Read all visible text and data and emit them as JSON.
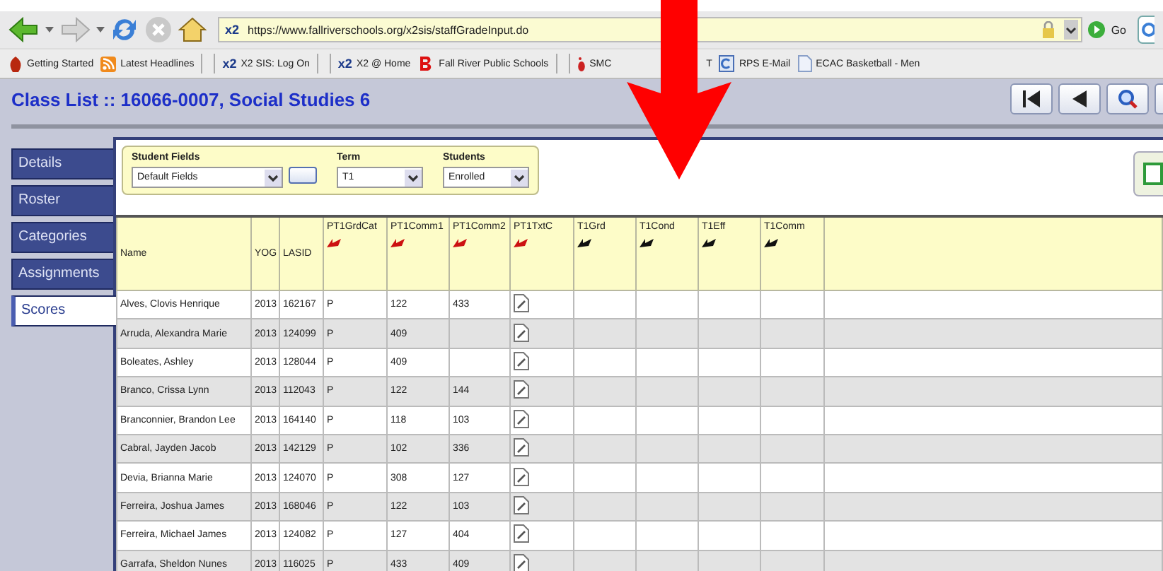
{
  "browser": {
    "site_badge": "x2",
    "url": "https://www.fallriverschools.org/x2sis/staffGradeInput.do",
    "go_label": "Go",
    "bookmarks": [
      {
        "label": "Getting Started",
        "kind": "start"
      },
      {
        "label": "Latest Headlines",
        "kind": "rss"
      },
      {
        "label": "X2 SIS: Log On",
        "kind": "x2",
        "badge": "x2"
      },
      {
        "label": "X2 @ Home",
        "kind": "x2",
        "badge": "x2"
      },
      {
        "label": "Fall River Public Schools",
        "kind": "school"
      },
      {
        "label": "SMC",
        "kind": "foot"
      },
      {
        "label": "T",
        "kind": "none"
      },
      {
        "label": "RPS E-Mail",
        "kind": "mail"
      },
      {
        "label": "ECAC Basketball - Men",
        "kind": "page"
      }
    ]
  },
  "page_title": "Class List :: 16066-0007, Social Studies 6",
  "sidebar": {
    "items": [
      {
        "label": "Details",
        "selected": false
      },
      {
        "label": "Roster",
        "selected": false
      },
      {
        "label": "Categories",
        "selected": false
      },
      {
        "label": "Assignments",
        "selected": false
      },
      {
        "label": "Scores",
        "selected": true
      }
    ]
  },
  "filters": [
    {
      "label": "Student Fields",
      "value": "Default Fields",
      "more_button": true
    },
    {
      "label": "Term",
      "value": "T1",
      "more_button": false
    },
    {
      "label": "Students",
      "value": "Enrolled",
      "more_button": false
    }
  ],
  "table": {
    "columns": [
      {
        "label": "Name",
        "sortable": false
      },
      {
        "label": "YOG",
        "sortable": false
      },
      {
        "label": "LASID",
        "sortable": false
      },
      {
        "label": "PT1GrdCat",
        "sortable": true,
        "color": "#cc1111"
      },
      {
        "label": "PT1Comm1",
        "sortable": true,
        "color": "#cc1111"
      },
      {
        "label": "PT1Comm2",
        "sortable": true,
        "color": "#cc1111"
      },
      {
        "label": "PT1TxtC",
        "sortable": true,
        "color": "#cc1111"
      },
      {
        "label": "T1Grd",
        "sortable": true,
        "color": "#111111"
      },
      {
        "label": "T1Cond",
        "sortable": true,
        "color": "#111111"
      },
      {
        "label": "T1Eff",
        "sortable": true,
        "color": "#111111"
      },
      {
        "label": "T1Comm",
        "sortable": true,
        "color": "#111111"
      }
    ],
    "rows": [
      {
        "cells": [
          "Alves, Clovis Henrique",
          "2013",
          "162167",
          "P",
          "122",
          "433"
        ]
      },
      {
        "cells": [
          "Arruda, Alexandra Marie",
          "2013",
          "124099",
          "P",
          "409"
        ]
      },
      {
        "cells": [
          "Boleates, Ashley",
          "2013",
          "128044",
          "P",
          "409"
        ]
      },
      {
        "cells": [
          "Branco, Crissa Lynn",
          "2013",
          "112043",
          "P",
          "122",
          "144"
        ]
      },
      {
        "cells": [
          "Branconnier, Brandon Lee",
          "2013",
          "164140",
          "P",
          "118",
          "103"
        ]
      },
      {
        "cells": [
          "Cabral, Jayden Jacob",
          "2013",
          "142129",
          "P",
          "102",
          "336"
        ]
      },
      {
        "cells": [
          "Devia, Brianna Marie",
          "2013",
          "124070",
          "P",
          "308",
          "127"
        ]
      },
      {
        "cells": [
          "Ferreira, Joshua James",
          "2013",
          "168046",
          "P",
          "122",
          "103"
        ]
      },
      {
        "cells": [
          "Ferreira, Michael James",
          "2013",
          "124082",
          "P",
          "127",
          "404"
        ]
      },
      {
        "cells": [
          "Garrafa, Sheldon Nunes",
          "2013",
          "116025",
          "P",
          "433",
          "409"
        ]
      }
    ]
  }
}
